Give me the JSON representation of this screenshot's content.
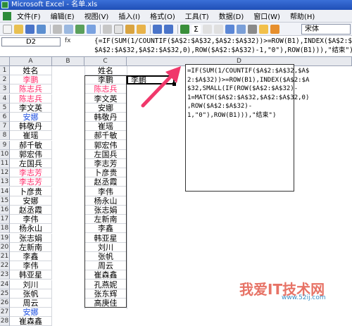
{
  "window": {
    "title": "Microsoft Excel - 名单.xls"
  },
  "menu": [
    "文件(F)",
    "编辑(E)",
    "视图(V)",
    "插入(I)",
    "格式(O)",
    "工具(T)",
    "数据(D)",
    "窗口(W)",
    "帮助(H)"
  ],
  "toolbar": {
    "font_name": "宋体",
    "zoom_icon": "magnifier-icon"
  },
  "formula_bar": {
    "name_box": "D2",
    "fx_label": "fx",
    "formula": "{=IF(SUM(1/COUNTIF($A$2:$A$32,$A$2:$A$32))>=ROW(B1),INDEX($A$2:$A$32,SMALL(IF(ROW($A$2:$A$32)-1=MATCH(\n$A$2:$A$32,$A$2:$A$32,0),ROW($A$2:$A$32)-1,\"0\"),ROW(B1))),\"结束\")}"
  },
  "columns": [
    "A",
    "B",
    "C",
    "D"
  ],
  "rows": [
    "1",
    "2",
    "3",
    "4",
    "5",
    "6",
    "7",
    "8",
    "9",
    "10",
    "11",
    "12",
    "13",
    "14",
    "15",
    "16",
    "17",
    "18",
    "19",
    "20",
    "21",
    "22",
    "23",
    "24",
    "25",
    "26",
    "27",
    "28"
  ],
  "colA": [
    {
      "t": "姓名",
      "c": ""
    },
    {
      "t": "李鹏",
      "c": "red"
    },
    {
      "t": "陈志兵",
      "c": "red"
    },
    {
      "t": "陈志兵",
      "c": "red"
    },
    {
      "t": "李文英",
      "c": ""
    },
    {
      "t": "安娜",
      "c": "blue"
    },
    {
      "t": "韩敬丹",
      "c": ""
    },
    {
      "t": "崔瑶",
      "c": ""
    },
    {
      "t": "郝千敏",
      "c": ""
    },
    {
      "t": "郭宏伟",
      "c": ""
    },
    {
      "t": "左国兵",
      "c": ""
    },
    {
      "t": "李志芳",
      "c": "red"
    },
    {
      "t": "李志芳",
      "c": "red"
    },
    {
      "t": "卜彦贵",
      "c": ""
    },
    {
      "t": "安娜",
      "c": ""
    },
    {
      "t": "赵丞霞",
      "c": ""
    },
    {
      "t": "李伟",
      "c": ""
    },
    {
      "t": "杨永山",
      "c": ""
    },
    {
      "t": "张志娟",
      "c": ""
    },
    {
      "t": "左新南",
      "c": ""
    },
    {
      "t": "李鑫",
      "c": ""
    },
    {
      "t": "李伟",
      "c": ""
    },
    {
      "t": "韩亚星",
      "c": ""
    },
    {
      "t": "刘川",
      "c": ""
    },
    {
      "t": "张帆",
      "c": ""
    },
    {
      "t": "周云",
      "c": ""
    },
    {
      "t": "安娜",
      "c": "blue"
    },
    {
      "t": "崔森鑫",
      "c": ""
    }
  ],
  "colC": [
    "姓名",
    "李鹏",
    "陈志兵",
    "李文英",
    "安娜",
    "韩敬丹",
    "崔瑶",
    "郝千敏",
    "郭宏伟",
    "左国兵",
    "李志芳",
    "卜彦贵",
    "赵丞霞",
    "李伟",
    "杨永山",
    "张志娟",
    "左新南",
    "李鑫",
    "韩亚星",
    "刘川",
    "张帆",
    "周云",
    "崔森鑫",
    "孔燕妮",
    "张东辉",
    "高庚佳"
  ],
  "colC_colors": {
    "2": "red"
  },
  "selected_cell": {
    "value": "李鹏"
  },
  "tooltip": {
    "text": "=IF(SUM(1/COUNTIF($A$2:$A$32,$A$\n2:$A$32))>=ROW(B1),INDEX($A$2:$A\n$32,SMALL(IF(ROW($A$2:$A$32)-\n1=MATCH($A$2:$A$32,$A$2:$A$32,0)\n,ROW($A$2:$A$32)-\n1,\"0\"),ROW(B1))),\"结束\")"
  },
  "watermark": {
    "main": "我爱IT技术网",
    "sub": "www.52ij.com"
  },
  "arrow_color": "#f0386b"
}
